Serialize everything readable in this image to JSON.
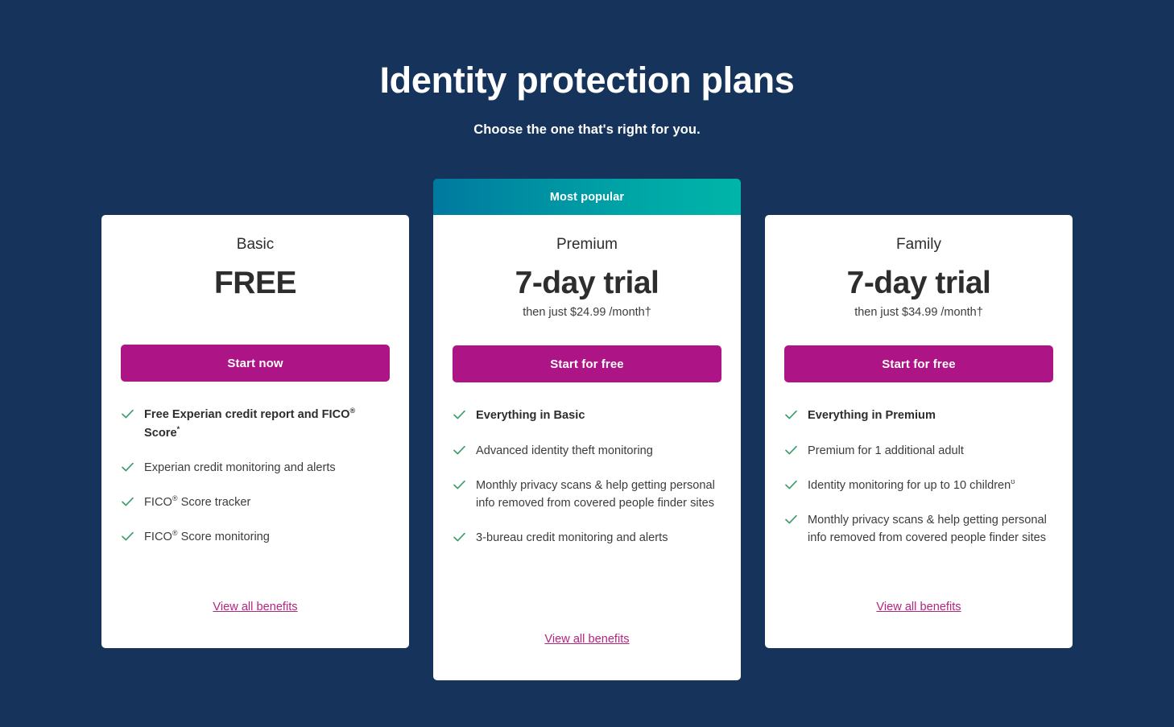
{
  "header": {
    "title": "Identity protection plans",
    "subtitle": "Choose the one that's right for you."
  },
  "colors": {
    "background": "#15335b",
    "card": "#ffffff",
    "cta": "#ad1486",
    "link": "#b3247f",
    "check": "#3f9c6d",
    "ribbon_from": "#00799f",
    "ribbon_to": "#00b5a9"
  },
  "plans": [
    {
      "name": "Basic",
      "price": "FREE",
      "price_note": "",
      "ribbon": "",
      "cta_label": "Start now",
      "benefits_link": "View all benefits",
      "features": [
        {
          "text": "Free Experian credit report and FICO",
          "sup": "®",
          "text2": " Score",
          "sup2": "*",
          "bold": true
        },
        {
          "text": "Experian credit monitoring and alerts",
          "bold": false
        },
        {
          "text": "FICO",
          "sup": "®",
          "text2": " Score tracker",
          "bold": false
        },
        {
          "text": "FICO",
          "sup": "®",
          "text2": " Score monitoring",
          "bold": false
        }
      ]
    },
    {
      "name": "Premium",
      "price": "7-day trial",
      "price_note": "then just $24.99 /month†",
      "ribbon": "Most popular",
      "cta_label": "Start for free",
      "benefits_link": "View all benefits",
      "features": [
        {
          "text": "Everything in Basic",
          "bold": true
        },
        {
          "text": "Advanced identity theft monitoring",
          "bold": false
        },
        {
          "text": "Monthly privacy scans & help getting personal info removed from covered people finder sites",
          "bold": false
        },
        {
          "text": "3-bureau credit monitoring and alerts",
          "bold": false
        }
      ]
    },
    {
      "name": "Family",
      "price": "7-day trial",
      "price_note": "then just $34.99 /month†",
      "ribbon": "",
      "cta_label": "Start for free",
      "benefits_link": "View all benefits",
      "features": [
        {
          "text": "Everything in Premium",
          "bold": true
        },
        {
          "text": "Premium for 1 additional adult",
          "bold": false
        },
        {
          "text": "Identity monitoring for up to 10 children",
          "sup": "ʊ",
          "bold": false
        },
        {
          "text": "Monthly privacy scans & help getting personal info removed from covered people finder sites",
          "bold": false
        }
      ]
    }
  ]
}
